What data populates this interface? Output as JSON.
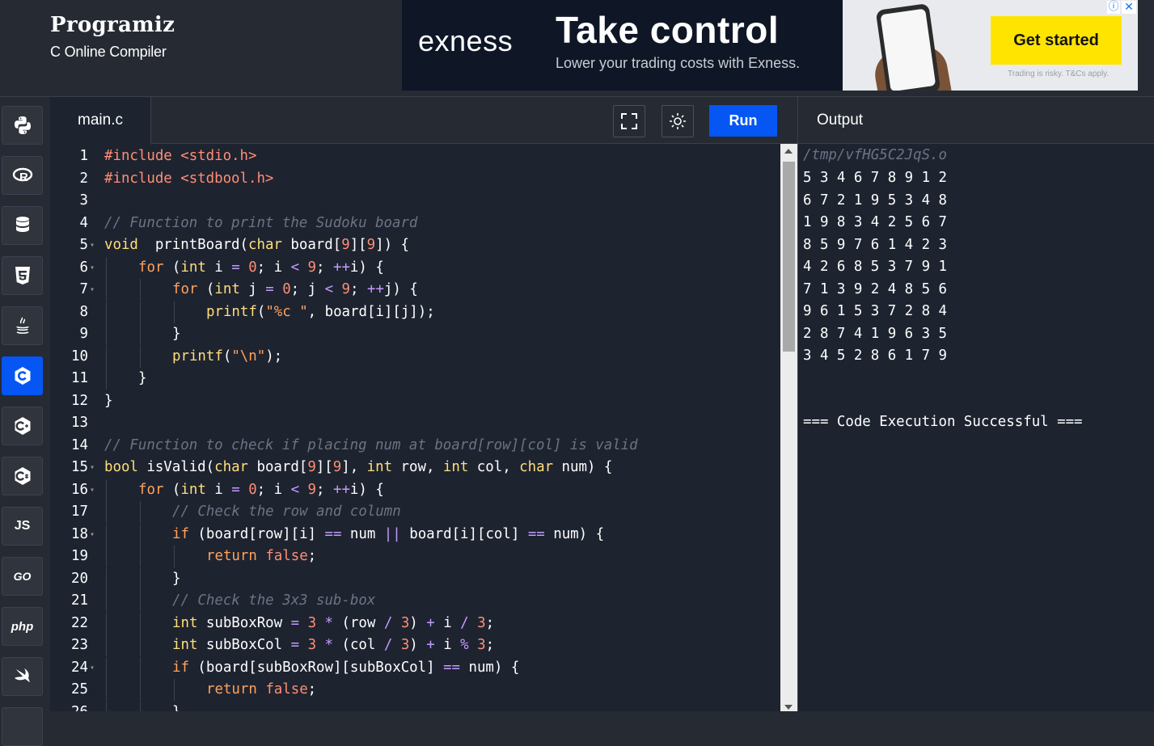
{
  "brand": {
    "logo": "Programiz",
    "subtitle": "C Online Compiler"
  },
  "ad": {
    "logo": "exness",
    "headline": "Take control",
    "subline": "Lower your trading costs with Exness.",
    "cta": "Get started",
    "risk": "Trading is risky. T&Cs apply.",
    "info_icon": "info-icon",
    "close_icon": "close-icon"
  },
  "sidebar": {
    "items": [
      {
        "name": "python",
        "icon": "python-icon",
        "label": ""
      },
      {
        "name": "r",
        "icon": "r-icon",
        "label": ""
      },
      {
        "name": "sql",
        "icon": "database-icon",
        "label": ""
      },
      {
        "name": "html",
        "icon": "html5-icon",
        "label": ""
      },
      {
        "name": "java",
        "icon": "java-icon",
        "label": ""
      },
      {
        "name": "c",
        "icon": "c-icon",
        "label": "",
        "active": true
      },
      {
        "name": "cpp",
        "icon": "cpp-icon",
        "label": ""
      },
      {
        "name": "csharp",
        "icon": "csharp-icon",
        "label": ""
      },
      {
        "name": "js",
        "icon": "js-icon",
        "label": "JS"
      },
      {
        "name": "go",
        "icon": "go-icon",
        "label": "GO"
      },
      {
        "name": "php",
        "icon": "php-icon",
        "label": "php"
      },
      {
        "name": "swift",
        "icon": "swift-icon",
        "label": ""
      }
    ]
  },
  "editor": {
    "tab": "main.c",
    "fullscreen_icon": "fullscreen-icon",
    "theme_icon": "sun-icon",
    "run_label": "Run",
    "lines": [
      {
        "n": "1",
        "indent": 0,
        "fold": false,
        "tokens": [
          [
            "pp",
            "#include "
          ],
          [
            "inc",
            "<stdio.h>"
          ]
        ]
      },
      {
        "n": "2",
        "indent": 0,
        "fold": false,
        "tokens": [
          [
            "pp",
            "#include "
          ],
          [
            "inc",
            "<stdbool.h>"
          ]
        ]
      },
      {
        "n": "3",
        "indent": 0,
        "fold": false,
        "tokens": []
      },
      {
        "n": "4",
        "indent": 0,
        "fold": false,
        "tokens": [
          [
            "cm",
            "// Function to print the Sudoku board"
          ]
        ]
      },
      {
        "n": "5",
        "indent": 0,
        "fold": true,
        "tokens": [
          [
            "ty",
            "void"
          ],
          [
            "",
            "  printBoard("
          ],
          [
            "ty",
            "char"
          ],
          [
            "",
            " board["
          ],
          [
            "num",
            "9"
          ],
          [
            "",
            "]["
          ],
          [
            "num",
            "9"
          ],
          [
            "",
            "]) {"
          ]
        ]
      },
      {
        "n": "6",
        "indent": 1,
        "fold": true,
        "tokens": [
          [
            "kw",
            "for"
          ],
          [
            "",
            " ("
          ],
          [
            "ty",
            "int"
          ],
          [
            "",
            " i "
          ],
          [
            "op",
            "="
          ],
          [
            "",
            " "
          ],
          [
            "num",
            "0"
          ],
          [
            "",
            "; i "
          ],
          [
            "op",
            "<"
          ],
          [
            "",
            " "
          ],
          [
            "num",
            "9"
          ],
          [
            "",
            "; "
          ],
          [
            "op",
            "++"
          ],
          [
            "",
            "i) {"
          ]
        ]
      },
      {
        "n": "7",
        "indent": 2,
        "fold": true,
        "tokens": [
          [
            "kw",
            "for"
          ],
          [
            "",
            " ("
          ],
          [
            "ty",
            "int"
          ],
          [
            "",
            " j "
          ],
          [
            "op",
            "="
          ],
          [
            "",
            " "
          ],
          [
            "num",
            "0"
          ],
          [
            "",
            "; j "
          ],
          [
            "op",
            "<"
          ],
          [
            "",
            " "
          ],
          [
            "num",
            "9"
          ],
          [
            "",
            "; "
          ],
          [
            "op",
            "++"
          ],
          [
            "",
            "j) {"
          ]
        ]
      },
      {
        "n": "8",
        "indent": 3,
        "fold": false,
        "tokens": [
          [
            "fn",
            "printf"
          ],
          [
            "",
            "("
          ],
          [
            "str",
            "\"%c \""
          ],
          [
            "",
            ", board[i][j]);"
          ]
        ]
      },
      {
        "n": "9",
        "indent": 2,
        "fold": false,
        "tokens": [
          [
            "",
            "}"
          ]
        ]
      },
      {
        "n": "10",
        "indent": 2,
        "fold": false,
        "tokens": [
          [
            "fn",
            "printf"
          ],
          [
            "",
            "("
          ],
          [
            "str",
            "\"\\n\""
          ],
          [
            "",
            ");"
          ]
        ]
      },
      {
        "n": "11",
        "indent": 1,
        "fold": false,
        "tokens": [
          [
            "",
            "}"
          ]
        ]
      },
      {
        "n": "12",
        "indent": 0,
        "fold": false,
        "tokens": [
          [
            "",
            "}"
          ]
        ]
      },
      {
        "n": "13",
        "indent": 0,
        "fold": false,
        "tokens": []
      },
      {
        "n": "14",
        "indent": 0,
        "fold": false,
        "tokens": [
          [
            "cm",
            "// Function to check if placing num at board[row][col] is valid"
          ]
        ]
      },
      {
        "n": "15",
        "indent": 0,
        "fold": true,
        "tokens": [
          [
            "ty",
            "bool"
          ],
          [
            "",
            " isValid("
          ],
          [
            "ty",
            "char"
          ],
          [
            "",
            " board["
          ],
          [
            "num",
            "9"
          ],
          [
            "",
            "]["
          ],
          [
            "num",
            "9"
          ],
          [
            "",
            "], "
          ],
          [
            "ty",
            "int"
          ],
          [
            "",
            " row, "
          ],
          [
            "ty",
            "int"
          ],
          [
            "",
            " col, "
          ],
          [
            "ty",
            "char"
          ],
          [
            "",
            " num) {"
          ]
        ]
      },
      {
        "n": "16",
        "indent": 1,
        "fold": true,
        "tokens": [
          [
            "kw",
            "for"
          ],
          [
            "",
            " ("
          ],
          [
            "ty",
            "int"
          ],
          [
            "",
            " i "
          ],
          [
            "op",
            "="
          ],
          [
            "",
            " "
          ],
          [
            "num",
            "0"
          ],
          [
            "",
            "; i "
          ],
          [
            "op",
            "<"
          ],
          [
            "",
            " "
          ],
          [
            "num",
            "9"
          ],
          [
            "",
            "; "
          ],
          [
            "op",
            "++"
          ],
          [
            "",
            "i) {"
          ]
        ]
      },
      {
        "n": "17",
        "indent": 2,
        "fold": false,
        "tokens": [
          [
            "cm",
            "// Check the row and column"
          ]
        ]
      },
      {
        "n": "18",
        "indent": 2,
        "fold": true,
        "tokens": [
          [
            "kw",
            "if"
          ],
          [
            "",
            " (board[row][i] "
          ],
          [
            "op",
            "=="
          ],
          [
            "",
            " num "
          ],
          [
            "op",
            "||"
          ],
          [
            "",
            " board[i][col] "
          ],
          [
            "op",
            "=="
          ],
          [
            "",
            " num) {"
          ]
        ]
      },
      {
        "n": "19",
        "indent": 3,
        "fold": false,
        "tokens": [
          [
            "kw",
            "return"
          ],
          [
            "",
            " "
          ],
          [
            "num",
            "false"
          ],
          [
            "",
            ";"
          ]
        ]
      },
      {
        "n": "20",
        "indent": 2,
        "fold": false,
        "tokens": [
          [
            "",
            "}"
          ]
        ]
      },
      {
        "n": "21",
        "indent": 2,
        "fold": false,
        "tokens": [
          [
            "cm",
            "// Check the 3x3 sub-box"
          ]
        ]
      },
      {
        "n": "22",
        "indent": 2,
        "fold": false,
        "tokens": [
          [
            "ty",
            "int"
          ],
          [
            "",
            " subBoxRow "
          ],
          [
            "op",
            "="
          ],
          [
            "",
            " "
          ],
          [
            "num",
            "3"
          ],
          [
            "",
            " "
          ],
          [
            "op",
            "*"
          ],
          [
            "",
            " (row "
          ],
          [
            "op",
            "/"
          ],
          [
            "",
            " "
          ],
          [
            "num",
            "3"
          ],
          [
            "",
            ") "
          ],
          [
            "op",
            "+"
          ],
          [
            "",
            " i "
          ],
          [
            "op",
            "/"
          ],
          [
            "",
            " "
          ],
          [
            "num",
            "3"
          ],
          [
            "",
            ";"
          ]
        ]
      },
      {
        "n": "23",
        "indent": 2,
        "fold": false,
        "tokens": [
          [
            "ty",
            "int"
          ],
          [
            "",
            " subBoxCol "
          ],
          [
            "op",
            "="
          ],
          [
            "",
            " "
          ],
          [
            "num",
            "3"
          ],
          [
            "",
            " "
          ],
          [
            "op",
            "*"
          ],
          [
            "",
            " (col "
          ],
          [
            "op",
            "/"
          ],
          [
            "",
            " "
          ],
          [
            "num",
            "3"
          ],
          [
            "",
            ") "
          ],
          [
            "op",
            "+"
          ],
          [
            "",
            " i "
          ],
          [
            "op",
            "%"
          ],
          [
            "",
            " "
          ],
          [
            "num",
            "3"
          ],
          [
            "",
            ";"
          ]
        ]
      },
      {
        "n": "24",
        "indent": 2,
        "fold": true,
        "tokens": [
          [
            "kw",
            "if"
          ],
          [
            "",
            " (board[subBoxRow][subBoxCol] "
          ],
          [
            "op",
            "=="
          ],
          [
            "",
            " num) {"
          ]
        ]
      },
      {
        "n": "25",
        "indent": 3,
        "fold": false,
        "tokens": [
          [
            "kw",
            "return"
          ],
          [
            "",
            " "
          ],
          [
            "num",
            "false"
          ],
          [
            "",
            ";"
          ]
        ]
      },
      {
        "n": "26",
        "indent": 2,
        "fold": false,
        "tokens": [
          [
            "",
            "}"
          ]
        ]
      }
    ]
  },
  "output": {
    "title": "Output",
    "path": "/tmp/vfHG5C2JqS.o",
    "rows": [
      "5 3 4 6 7 8 9 1 2",
      "6 7 2 1 9 5 3 4 8",
      "1 9 8 3 4 2 5 6 7",
      "8 5 9 7 6 1 4 2 3",
      "4 2 6 8 5 3 7 9 1",
      "7 1 3 9 2 4 8 5 6",
      "9 6 1 5 3 7 2 8 4",
      "2 8 7 4 1 9 6 3 5",
      "3 4 5 2 8 6 1 7 9"
    ],
    "status": "=== Code Execution Successful ==="
  }
}
